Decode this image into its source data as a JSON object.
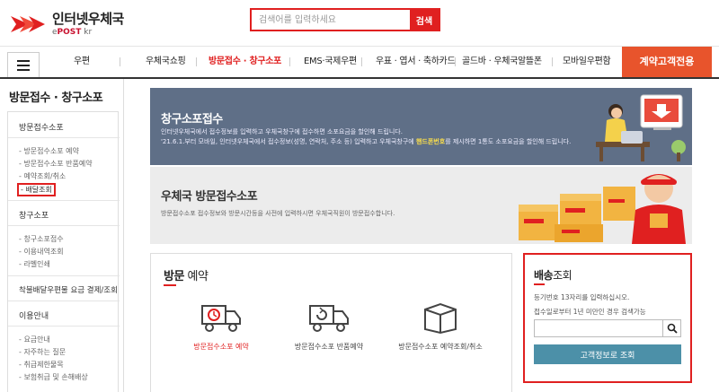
{
  "header": {
    "logo_kor": "인터넷우체국",
    "logo_eng_prefix": "e",
    "logo_eng_main": "POST",
    "logo_eng_suffix": "kr",
    "search_placeholder": "검색어를 입력하세요",
    "search_button": "검색"
  },
  "nav": {
    "items": [
      {
        "label": "우편"
      },
      {
        "label": "우체국쇼핑"
      },
      {
        "label": "방문접수 · 창구소포",
        "active": true
      },
      {
        "label": "EMS·국제우편"
      },
      {
        "label": "우표 · 엽서 · 축하카드"
      },
      {
        "label": "골드바 · 우체국알뜰폰"
      },
      {
        "label": "모바일우편함"
      }
    ],
    "cta": "계약고객전용"
  },
  "sidebar": {
    "title": "방문접수 · 창구소포",
    "group1": "방문접수소포",
    "group1_items": [
      "방문접수소포 예약",
      "방문접수소포 반품예약",
      "예약조회/취소",
      "배달조회"
    ],
    "group2": "창구소포",
    "group2_items": [
      "창구소포접수",
      "이용내역조회",
      "라벨인쇄"
    ],
    "group3": "착불배달우편물 요금 결제/조회",
    "group4": "이용안내",
    "group4_items": [
      "요금안내",
      "자주하는 질문",
      "취급제한물목",
      "보험취급 및 손해배상"
    ]
  },
  "banner1": {
    "title": "창구소포접수",
    "line1": "인터넷우체국에서 접수정보를 입력하고 우체국창구에 접수하면 소포요금을 할인해 드립니다.",
    "line2_pre": "'21.6.1.부터 모바일, 인터넷우체국에서 접수정보(성명, 연락처, 주소 등) 입력하고 우체국창구에 ",
    "line2_hl": "핸드폰번호",
    "line2_post": "를 제시하면 1통도 소포요금을 할인해 드립니다."
  },
  "banner2": {
    "title": "우체국 방문접수소포",
    "text": "방문접수소포 접수정보와 방문시간등을 사전에 입력하시면 우체국직원이 방문접수합니다."
  },
  "visit": {
    "title_bold": "방문",
    "title_thin": " 예약",
    "options": [
      {
        "label": "방문접수소포 예약",
        "icon": "delivery-truck-icon"
      },
      {
        "label": "방문접수소포 반품예약",
        "icon": "return-truck-icon"
      },
      {
        "label": "방문접수소포 예약조회/취소",
        "icon": "box-icon"
      }
    ]
  },
  "track": {
    "title_bold": "배송",
    "title_thin": "조회",
    "desc1": "등기번호 13자리를 입력하십시오.",
    "desc2": "접수일로부터 1년 미만인 경우 검색가능",
    "input_value": "",
    "button": "고객정보로 조회"
  },
  "colors": {
    "accent_red": "#e02020",
    "cta_orange": "#e8542c",
    "banner_blue": "#5f6f87",
    "button_teal": "#4c90a8"
  }
}
